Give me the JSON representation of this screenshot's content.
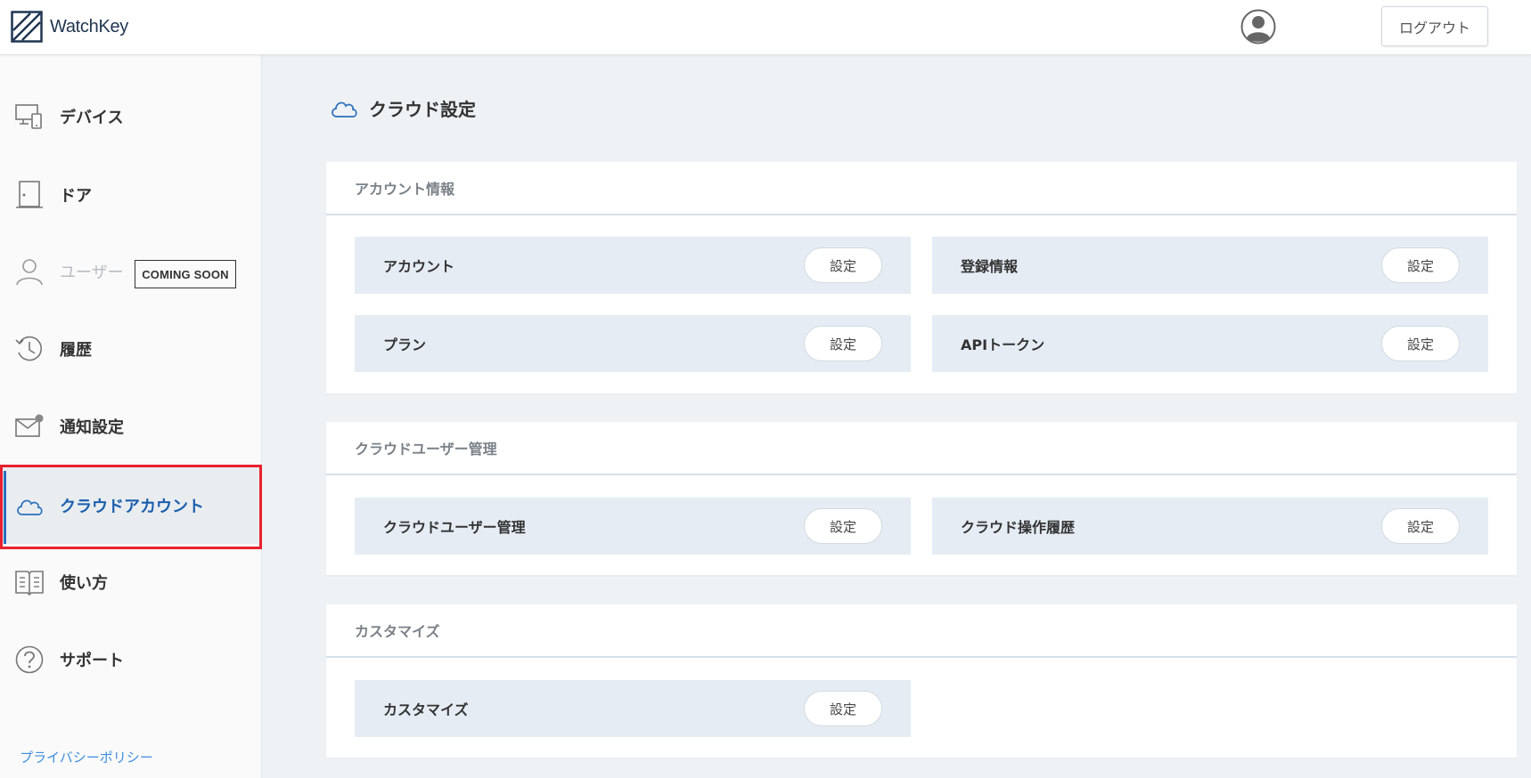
{
  "header": {
    "app_name": "WatchKey",
    "logout_label": "ログアウト"
  },
  "sidebar": {
    "items": [
      {
        "label": "デバイス",
        "icon": "device-icon"
      },
      {
        "label": "ドア",
        "icon": "door-icon"
      },
      {
        "label": "ユーザー",
        "icon": "user-icon",
        "badge": "COMING SOON",
        "disabled": true
      },
      {
        "label": "履歴",
        "icon": "history-icon"
      },
      {
        "label": "通知設定",
        "icon": "mail-notification-icon"
      },
      {
        "label": "クラウドアカウント",
        "icon": "cloud-icon",
        "active": true
      },
      {
        "label": "使い方",
        "icon": "book-icon"
      },
      {
        "label": "サポート",
        "icon": "help-icon"
      }
    ],
    "privacy_link": "プライバシーポリシー"
  },
  "main": {
    "title": "クラウド設定",
    "sections": [
      {
        "title": "アカウント情報",
        "rows": [
          {
            "label": "アカウント",
            "button": "設定"
          },
          {
            "label": "登録情報",
            "button": "設定"
          },
          {
            "label": "プラン",
            "button": "設定"
          },
          {
            "label": "APIトークン",
            "button": "設定"
          }
        ]
      },
      {
        "title": "クラウドユーザー管理",
        "rows": [
          {
            "label": "クラウドユーザー管理",
            "button": "設定"
          },
          {
            "label": "クラウド操作履歴",
            "button": "設定"
          }
        ]
      },
      {
        "title": "カスタマイズ",
        "rows": [
          {
            "label": "カスタマイズ",
            "button": "設定"
          }
        ]
      }
    ]
  },
  "colors": {
    "accent": "#1b5fad",
    "highlight_outline": "#e8212e",
    "row_background": "#e5ecf4",
    "page_background": "#eef2f5"
  }
}
